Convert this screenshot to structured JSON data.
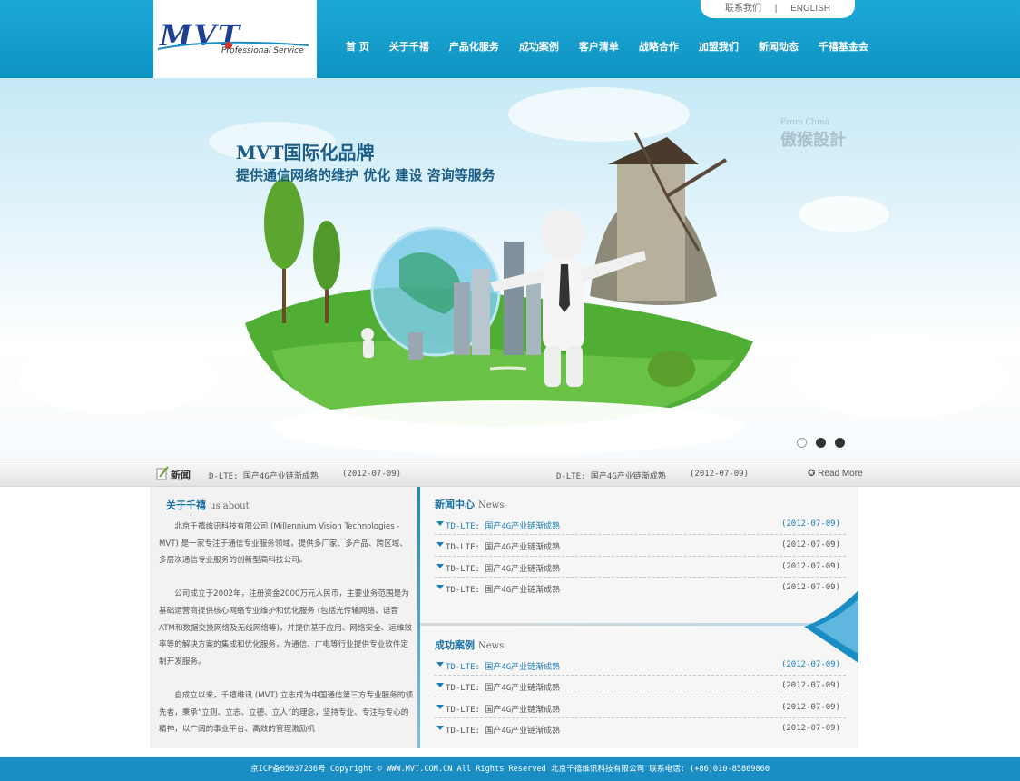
{
  "header": {
    "logo_text": "MVT",
    "logo_sub": "Professional Service",
    "top_links": [
      "联系我们",
      "|",
      "ENGLISH"
    ],
    "nav": [
      "首 页",
      "关于千禧",
      "产品化服务",
      "成功案例",
      "客户清单",
      "战略合作",
      "加盟我们",
      "新闻动态",
      "千禧基金会"
    ]
  },
  "banner": {
    "title": "MVT国际化品牌",
    "subtitle": "提供通信网络的维护 优化 建设 咨询等服务",
    "watermark_small": "From China",
    "watermark_large": "傲猴設計",
    "slide_dots": 3,
    "active_slide": 1
  },
  "ticker": {
    "label": "新闻",
    "items": [
      {
        "text": "D-LTE: 国产4G产业链渐成熟",
        "date": "(2012-07-09)"
      },
      {
        "text": "D-LTE: 国产4G产业链渐成熟",
        "date": "(2012-07-09)"
      }
    ],
    "read_more": "Read More"
  },
  "about": {
    "title": "关于千禧",
    "title_en": "us about",
    "paragraphs": [
      "北京千禧维讯科技有限公司 (Millennium Vision Technologies - MVT) 是一家专注于通信专业服务领域，提供多厂家、多产品、跨区域、多层次通信专业服务的创新型高科技公司。",
      "公司成立于2002年，注册资金2000万元人民币，主要业务范围是为基础运营商提供核心网络专业维护和优化服务 (包括光传输网络、语音ATM和数据交换网络及无线网络等)，并提供基于应用、网络安全、运维效率等的解决方案的集成和优化服务，为通信、广电等行业提供专业软件定制开发服务。",
      "自成立以来，千禧维讯 (MVT) 立志成为中国通信第三方专业服务的领先者，秉承“立则、立志、立德、立人”的理念，坚持专业、专注与专心的精神，以广阔的事业平台、高效的管理激励机"
    ]
  },
  "news_center": {
    "title": "新闻中心",
    "title_en": "News",
    "items": [
      {
        "text": "TD-LTE: 国产4G产业链渐成熟",
        "date": "(2012-07-09)"
      },
      {
        "text": "TD-LTE: 国产4G产业链渐成熟",
        "date": "(2012-07-09)"
      },
      {
        "text": "TD-LTE: 国产4G产业链渐成熟",
        "date": "(2012-07-09)"
      },
      {
        "text": "TD-LTE: 国产4G产业链渐成熟",
        "date": "(2012-07-09)"
      }
    ]
  },
  "cases": {
    "title": "成功案例",
    "title_en": "News",
    "items": [
      {
        "text": "TD-LTE: 国产4G产业链渐成熟",
        "date": "(2012-07-09)"
      },
      {
        "text": "TD-LTE: 国产4G产业链渐成熟",
        "date": "(2012-07-09)"
      },
      {
        "text": "TD-LTE: 国产4G产业链渐成熟",
        "date": "(2012-07-09)"
      },
      {
        "text": "TD-LTE: 国产4G产业链渐成熟",
        "date": "(2012-07-09)"
      }
    ]
  },
  "footer": {
    "text": "京ICP备05037236号 Copyright © WWW.MVT.COM.CN All Rights Reserved 北京千禧维讯科技有限公司 联系电话: (+86)010-85869860"
  },
  "colors": {
    "brand_blue": "#1a8ec4",
    "link_blue": "#1a7fb5",
    "logo_blue": "#1c3f8f"
  }
}
